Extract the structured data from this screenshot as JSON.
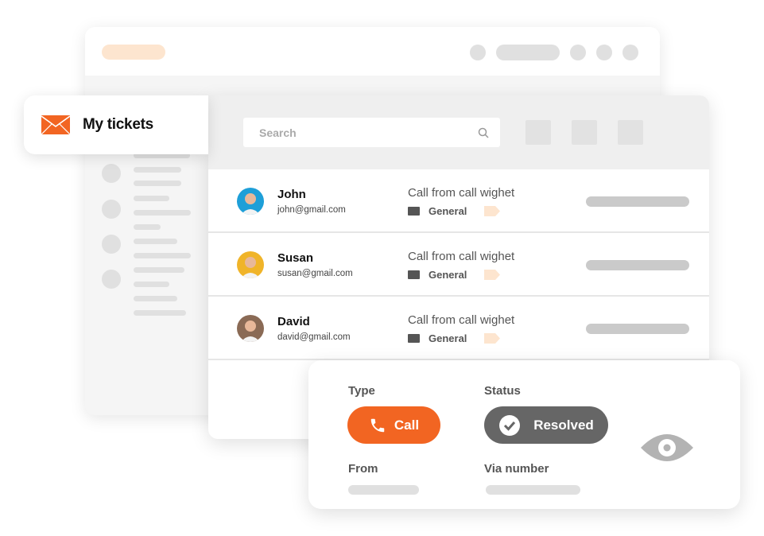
{
  "sidebar_card": {
    "title": "My tickets",
    "icon": "envelope-icon",
    "accent": "#f26522"
  },
  "search": {
    "placeholder": "Search"
  },
  "tickets": [
    {
      "name": "John",
      "email": "john@gmail.com",
      "subject": "Call from call wighet",
      "category": "General",
      "avatar_color": "#1e9fd8"
    },
    {
      "name": "Susan",
      "email": "susan@gmail.com",
      "subject": "Call from call wighet",
      "category": "General",
      "avatar_color": "#f0b429"
    },
    {
      "name": "David",
      "email": "david@gmail.com",
      "subject": "Call from call wighet",
      "category": "General",
      "avatar_color": "#8a6a55"
    }
  ],
  "detail": {
    "type_label": "Type",
    "type_value": "Call",
    "status_label": "Status",
    "status_value": "Resolved",
    "from_label": "From",
    "via_label": "Via number",
    "type_color": "#f26522",
    "status_color": "#666666"
  }
}
